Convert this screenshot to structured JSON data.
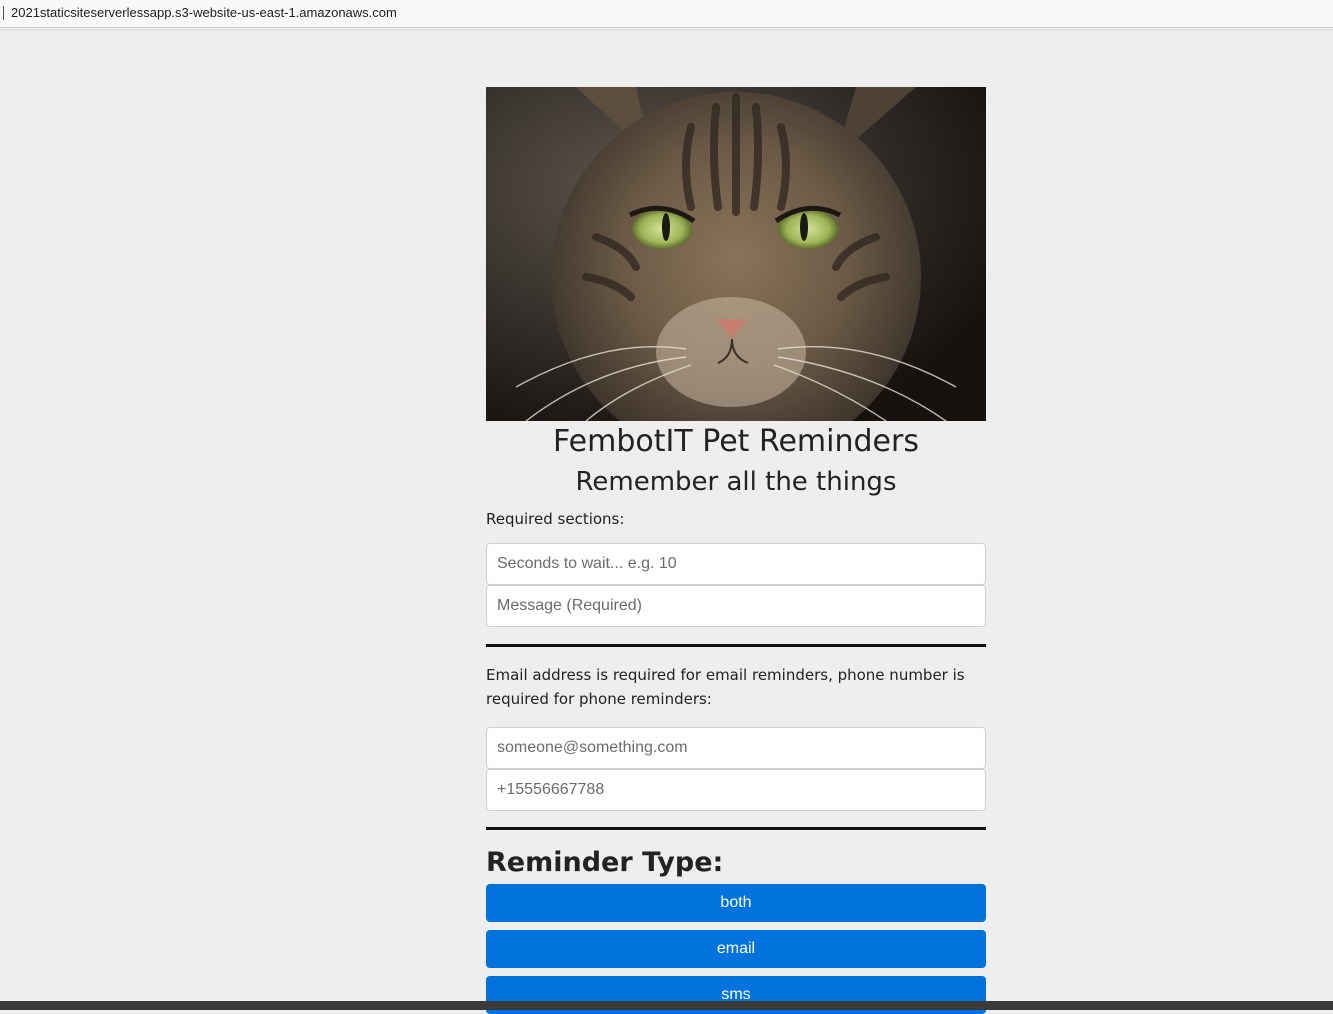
{
  "browser": {
    "url": "2021staticsiteserverlessapp.s3-website-us-east-1.amazonaws.com"
  },
  "header": {
    "title": "FembotIT Pet Reminders",
    "subtitle": "Remember all the things"
  },
  "required_section": {
    "label": "Required sections:",
    "seconds_placeholder": "Seconds to wait... e.g. 10",
    "message_placeholder": "Message (Required)"
  },
  "contact_section": {
    "label": "Email address is required for email reminders, phone number is required for phone reminders:",
    "email_placeholder": "someone@something.com",
    "phone_placeholder": "+15556667788"
  },
  "reminder_type": {
    "heading": "Reminder Type:",
    "buttons": [
      "both",
      "email",
      "sms"
    ]
  },
  "colors": {
    "button": "#0273dc",
    "page_background": "#eeeeee"
  }
}
